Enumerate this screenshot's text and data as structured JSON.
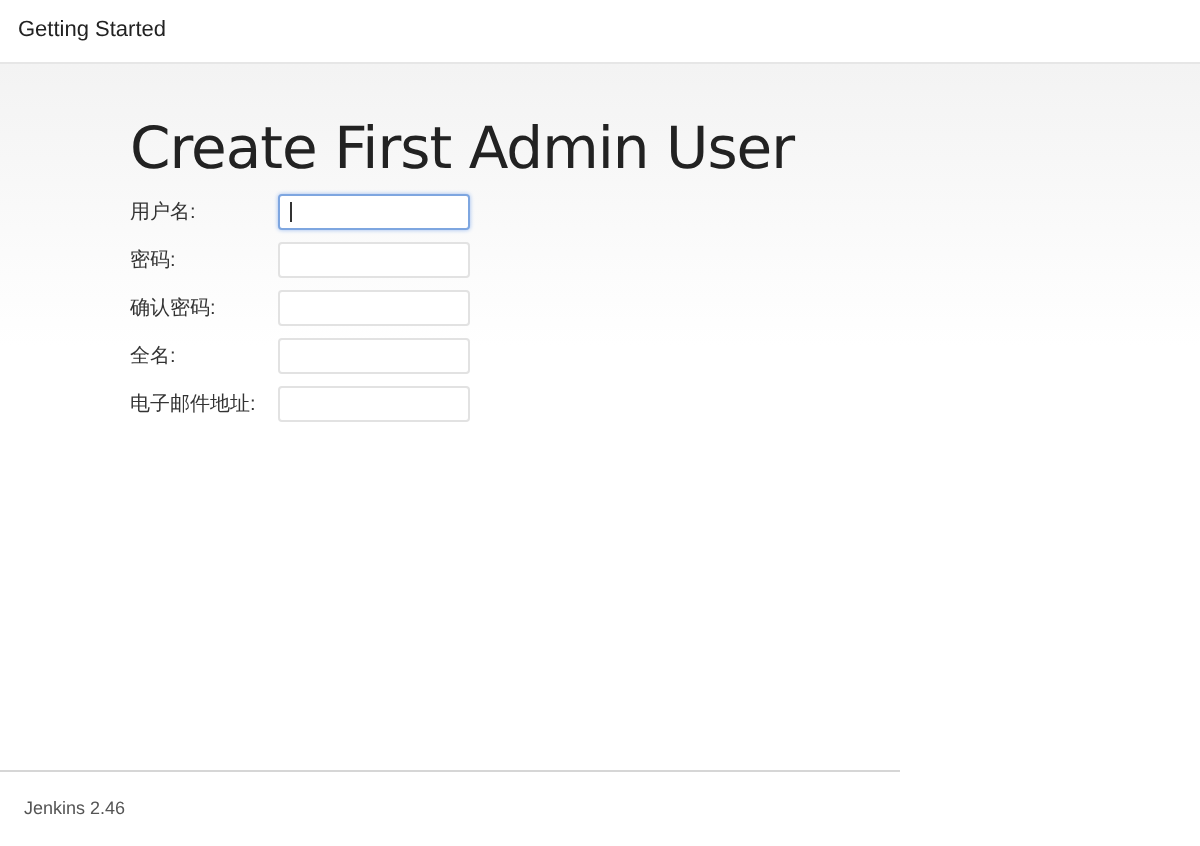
{
  "header": {
    "title": "Getting Started"
  },
  "page": {
    "heading": "Create First Admin User"
  },
  "form": {
    "fields": [
      {
        "label": "用户名:",
        "focused": true
      },
      {
        "label": "密码:",
        "focused": false
      },
      {
        "label": "确认密码:",
        "focused": false
      },
      {
        "label": "全名:",
        "focused": false
      },
      {
        "label": "电子邮件地址:",
        "focused": false
      }
    ]
  },
  "footer": {
    "version": "Jenkins 2.46"
  }
}
